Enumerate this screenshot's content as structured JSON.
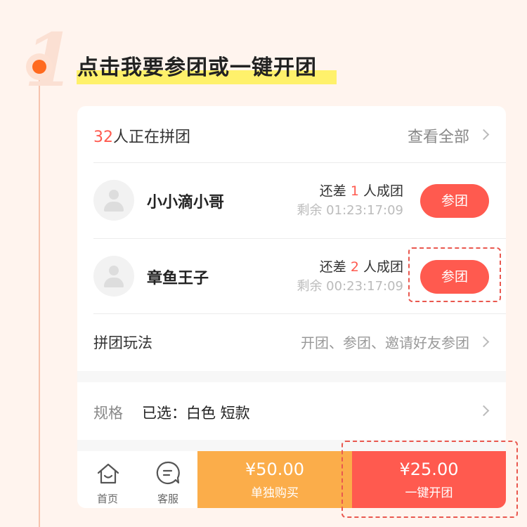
{
  "step": {
    "number": "1",
    "title": "点击我要参团或一键开团"
  },
  "header": {
    "count": "32",
    "count_suffix": "人正在拼团",
    "see_all": "查看全部"
  },
  "members": [
    {
      "name": "小小滴小哥",
      "need_prefix": "还差",
      "need_count": "1",
      "need_suffix": "人成团",
      "remain": "剩余 01:23:17:09",
      "button": "参团"
    },
    {
      "name": "章鱼王子",
      "need_prefix": "还差",
      "need_count": "2",
      "need_suffix": "人成团",
      "remain": "剩余 00:23:17:09",
      "button": "参团"
    }
  ],
  "rules": {
    "label": "拼团玩法",
    "value": "开团、参团、邀请好友参团"
  },
  "spec": {
    "label": "规格",
    "value": "已选：白色 短款"
  },
  "bottom": {
    "tabs": [
      {
        "label": "首页",
        "icon": "home-icon"
      },
      {
        "label": "客服",
        "icon": "customer-service-icon"
      }
    ],
    "single": {
      "price": "¥50.00",
      "label": "单独购买"
    },
    "group": {
      "price": "¥25.00",
      "label": "一键开团"
    }
  },
  "colors": {
    "accent": "#ff5a4f",
    "orange": "#fbad4a",
    "highlight": "#fff16b",
    "background": "#fff4ee"
  }
}
